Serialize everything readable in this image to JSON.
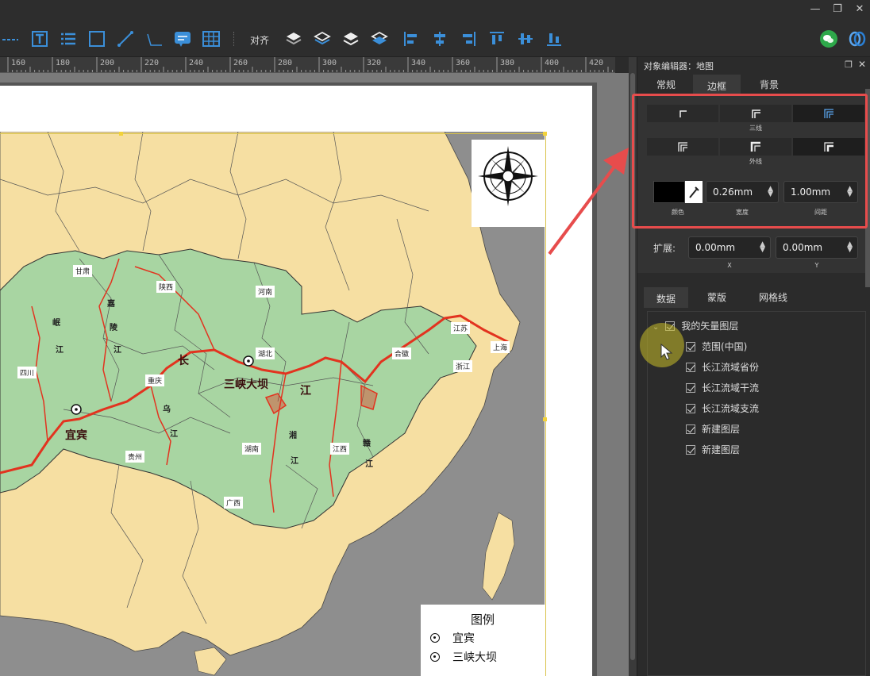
{
  "toolbar": {
    "align_label": "对齐"
  },
  "ruler": {
    "ticks": [
      "160",
      "180",
      "200",
      "220",
      "240",
      "260",
      "280",
      "300",
      "320",
      "340",
      "360",
      "380",
      "400",
      "420"
    ]
  },
  "map": {
    "labels": {
      "gansu": "甘肃",
      "shaanxi": "陕西",
      "henan": "河南",
      "hubei": "湖北",
      "anhui": "合徽",
      "jiangsu": "江苏",
      "shanghai": "上海",
      "zhejiang": "浙江",
      "sichuan": "四川",
      "chongqing": "重庆",
      "guizhou": "贵州",
      "hunan": "湖南",
      "jiangxi": "江西",
      "guangdong": "广西"
    },
    "river_labels": [
      "嘉",
      "陵",
      "江",
      "岷",
      "江",
      "乌",
      "江",
      "湘",
      "江",
      "赣",
      "江",
      "长",
      "江"
    ],
    "big_labels": {
      "yibin": "宜宾",
      "sanxia": "三峡大坝"
    },
    "legend": {
      "title": "图例",
      "items": [
        "宜宾",
        "三峡大坝"
      ]
    }
  },
  "panel": {
    "title": "对象编辑器：地图",
    "tabs_top": [
      "常规",
      "边框",
      "背景"
    ],
    "active_top_tab": "边框",
    "border": {
      "row1_label": "三线",
      "row2_label": "外线",
      "color_label": "颜色",
      "width_value": "0.26mm",
      "width_label": "宽度",
      "gap_value": "1.00mm",
      "gap_label": "间距"
    },
    "extend": {
      "label": "扩展:",
      "x_value": "0.00mm",
      "x_label": "X",
      "y_value": "0.00mm",
      "y_label": "Y"
    },
    "tabs_bottom": [
      "数据",
      "蒙版",
      "网格线"
    ],
    "layers": {
      "root": "我的矢量图层",
      "children": [
        "范围(中国)",
        "长江流域省份",
        "长江流域干流",
        "长江流域支流",
        "新建图层",
        "新建图层"
      ]
    }
  },
  "colors": {
    "basin_fill": "#a8d5a2",
    "land_fill": "#f6dfa2",
    "sea": "#8e8e8e",
    "river": "#e2331f",
    "highlight": "#e74c4c",
    "accent_green": "#2ea84a",
    "accent_blue": "#2a7fd4"
  }
}
